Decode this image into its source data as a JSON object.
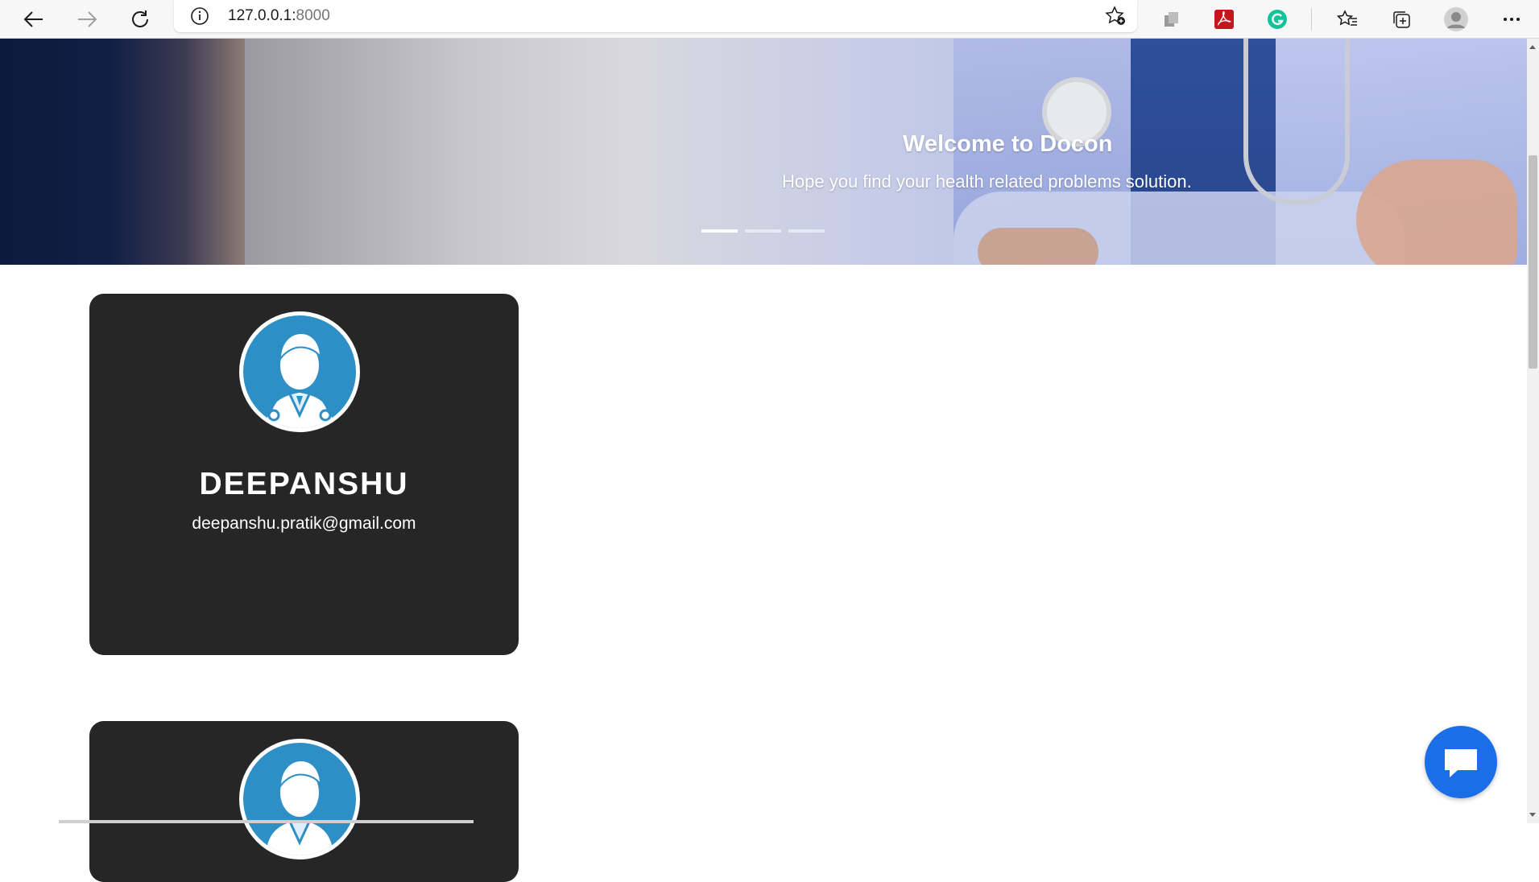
{
  "browser": {
    "url_host": "127.0.0.1:",
    "url_port": "8000",
    "icons": {
      "back": "arrow-left-icon",
      "forward": "arrow-right-icon",
      "reload": "reload-icon",
      "info": "info-icon",
      "favorite_add": "star-add-icon",
      "extension_1": "extension-icon",
      "acrobat": "adobe-acrobat-icon",
      "grammarly": "grammarly-icon",
      "favorites": "favorites-icon",
      "collections": "collections-icon",
      "profile": "profile-avatar-icon",
      "menu": "more-menu-icon"
    }
  },
  "hero": {
    "title": "Welcome to Docon",
    "subtitle": "Hope you find your health related problems solution.",
    "slides": 3,
    "active_slide": 1
  },
  "doctors": [
    {
      "name": "DEEPANSHU",
      "email": "deepanshu.pratik@gmail.com",
      "avatar_icon": "doctor-avatar-icon"
    },
    {
      "name": "",
      "email": "",
      "avatar_icon": "doctor-avatar-icon"
    }
  ],
  "chat": {
    "icon": "chat-bubble-icon"
  },
  "colors": {
    "card_bg": "#262626",
    "avatar_bg": "#2e8fc7",
    "chat_button": "#1a6fe8",
    "toolbar_bg": "#f7f7f7"
  }
}
